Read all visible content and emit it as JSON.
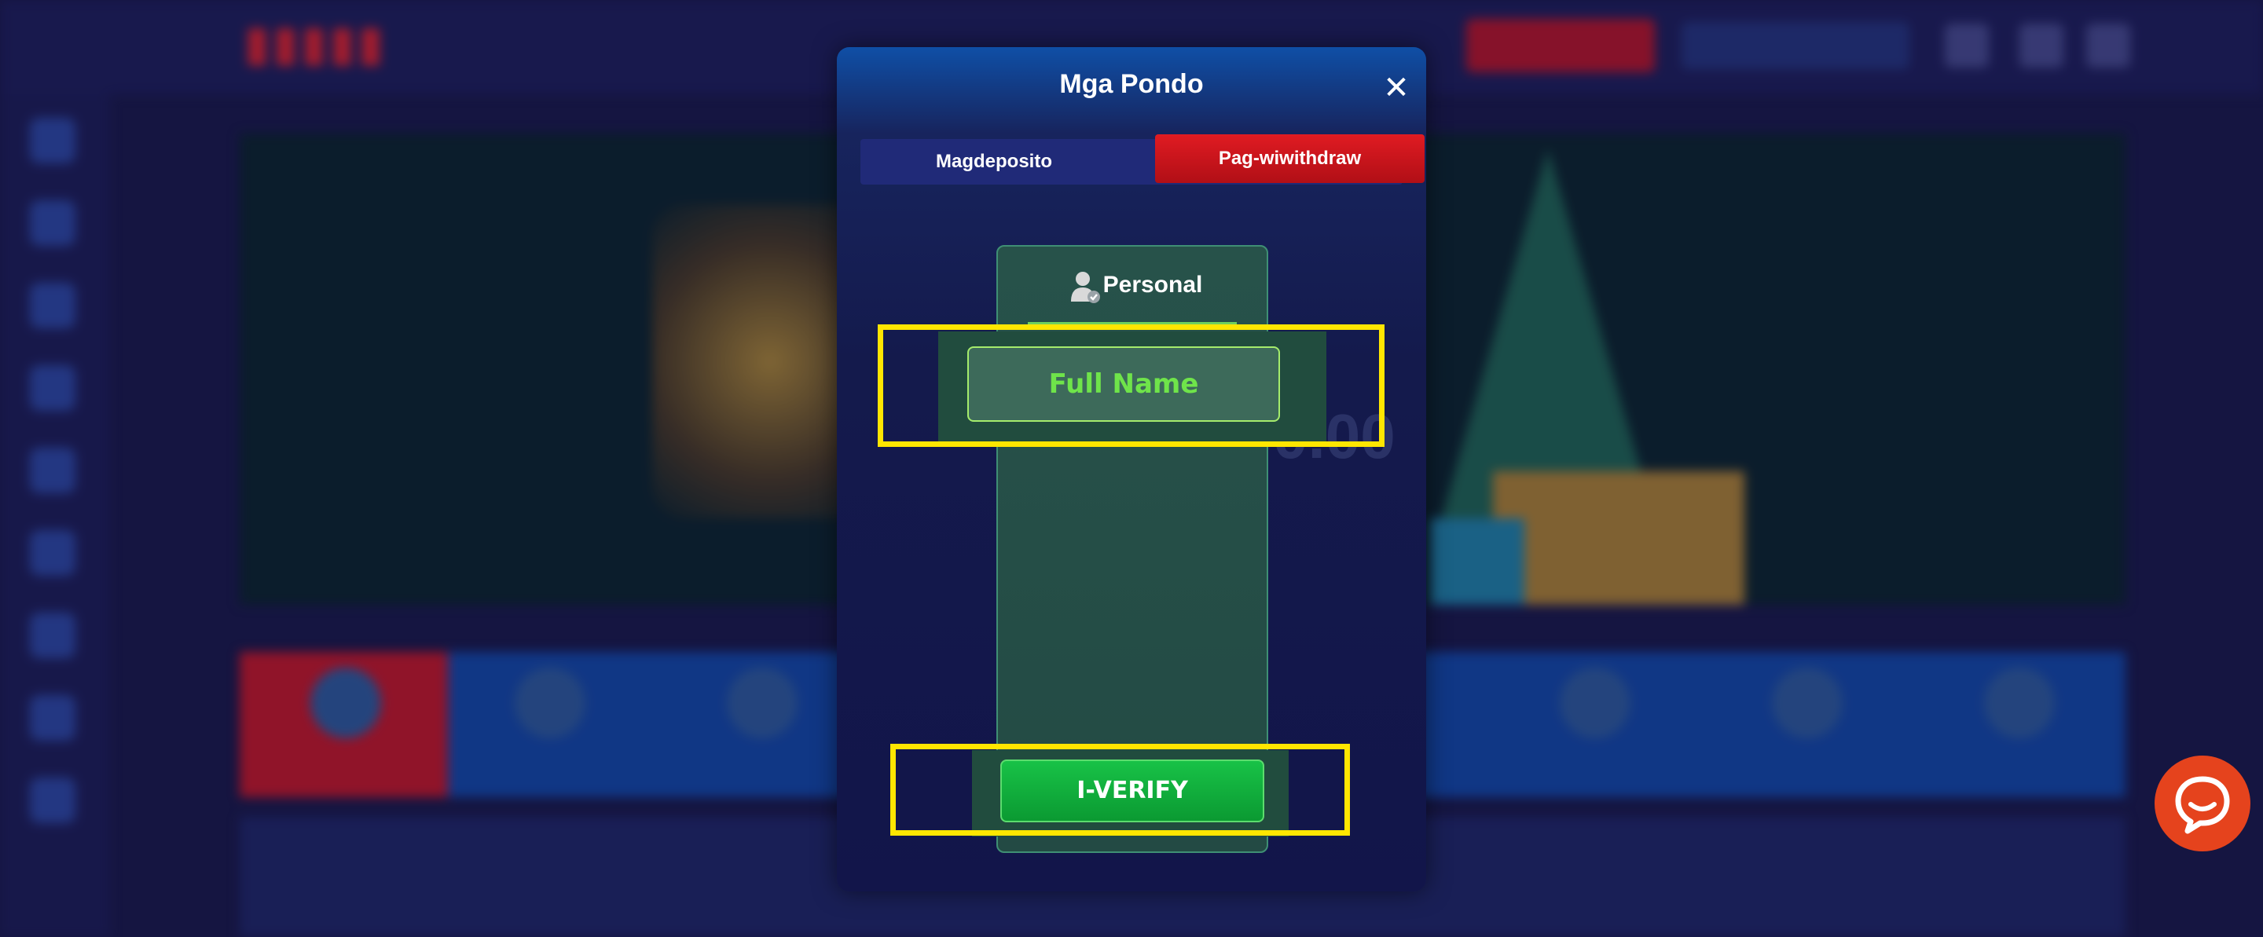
{
  "modal": {
    "title": "Mga Pondo",
    "close_icon": "close-icon",
    "tabs": [
      {
        "label": "Magdeposito",
        "active": false
      },
      {
        "label": "Pag-wiwithdraw",
        "active": true
      }
    ]
  },
  "verify_panel": {
    "heading": "Personal",
    "heading_icon": "user-verified-icon",
    "full_name_placeholder": "Full Name",
    "verify_button": "I-VERIFY"
  },
  "background": {
    "balance_ghost": "0.00"
  },
  "chat_icon": "chat-icon",
  "colors": {
    "accent_red": "#d3141b",
    "verify_green": "#0fa43a",
    "highlight_yellow": "#ffe600",
    "chat_orange": "#e5431d"
  }
}
